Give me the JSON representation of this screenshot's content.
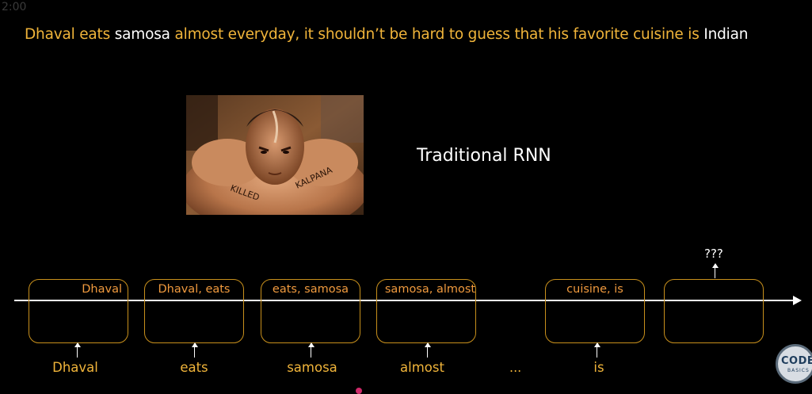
{
  "timestamp": "2:00",
  "headline": [
    {
      "text": "Dhaval eats ",
      "color": "orange"
    },
    {
      "text": "samosa",
      "color": "white"
    },
    {
      "text": " almost everyday, it shouldn’t be hard to guess that his favorite cuisine is ",
      "color": "orange"
    },
    {
      "text": "Indian",
      "color": "white"
    }
  ],
  "diagram_label": "Traditional RNN",
  "cells": [
    {
      "state": "Dhaval",
      "input": "Dhaval",
      "state_align": "right"
    },
    {
      "state": "Dhaval, eats",
      "input": "eats",
      "state_align": "center"
    },
    {
      "state": "eats, samosa",
      "input": "samosa",
      "state_align": "center"
    },
    {
      "state": "samosa, almost",
      "input": "almost",
      "state_align": "center"
    },
    {
      "state": "cuisine, is",
      "input": "is",
      "state_align": "center"
    },
    {
      "state": "",
      "input": "",
      "state_align": "center"
    }
  ],
  "ellipsis": "...",
  "prediction": "???",
  "logo": {
    "main": "CODE",
    "sub": "BASICS"
  },
  "colors": {
    "orange": "#f0b43a",
    "cell_border": "#c8901c",
    "state_text": "#f09a3e",
    "background": "#000000"
  }
}
